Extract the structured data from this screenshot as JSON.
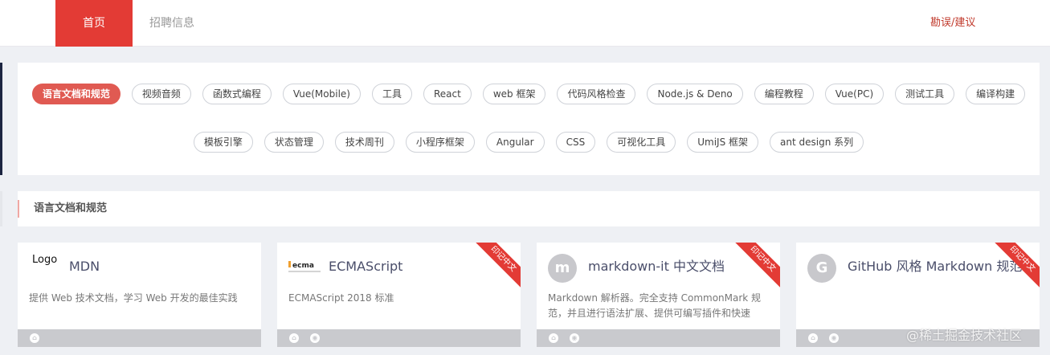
{
  "nav": {
    "home": "首页",
    "jobs": "招聘信息",
    "feedback": "勘误/建议"
  },
  "categories": {
    "row1": [
      "语言文档和规范",
      "视频音频",
      "函数式编程",
      "Vue(Mobile)",
      "工具",
      "React",
      "web 框架",
      "代码风格检查",
      "Node.js & Deno",
      "编程教程",
      "Vue(PC)",
      "测试工具",
      "编译构建"
    ],
    "row2": [
      "模板引擎",
      "状态管理",
      "技术周刊",
      "小程序框架",
      "Angular",
      "CSS",
      "可视化工具",
      "UmiJS 框架",
      "ant design 系列"
    ],
    "active": "语言文档和规范"
  },
  "section": {
    "title": "语言文档和规范"
  },
  "cards": [
    {
      "logo_text": "Logo",
      "title": "MDN",
      "desc": "提供 Web 技术文档，学习 Web 开发的最佳实践",
      "ribbon": ""
    },
    {
      "logo_text": "ecma",
      "title": "ECMAScript",
      "desc": "ECMAScript 2018 标准",
      "ribbon": "印记中文"
    },
    {
      "logo_letter": "m",
      "title": "markdown-it 中文文档",
      "desc": "Markdown 解析器。完全支持 CommonMark 规范，并且进行语法扩展、提供可编写插件和快速编...",
      "ribbon": "印记中文"
    },
    {
      "logo_letter": "G",
      "title": "GitHub 风格 Markdown 规范",
      "desc": "",
      "ribbon": "印记中文"
    }
  ],
  "watermark": "@稀土掘金技术社区",
  "colors": {
    "brand_red": "#e33b35",
    "tag_active": "#e05a52",
    "feedback": "#c0392b"
  }
}
